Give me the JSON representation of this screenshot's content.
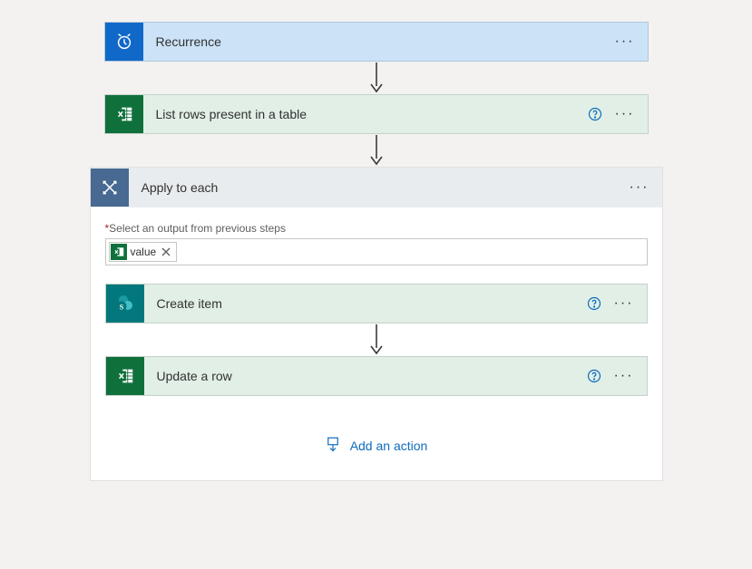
{
  "steps": {
    "recurrence": {
      "label": "Recurrence"
    },
    "listRows": {
      "label": "List rows present in a table"
    },
    "applyEach": {
      "label": "Apply to each",
      "fieldLabel": "Select an output from previous steps",
      "token": "value"
    },
    "createItem": {
      "label": "Create item"
    },
    "updateRow": {
      "label": "Update a row"
    }
  },
  "buttons": {
    "addAction": "Add an action"
  }
}
